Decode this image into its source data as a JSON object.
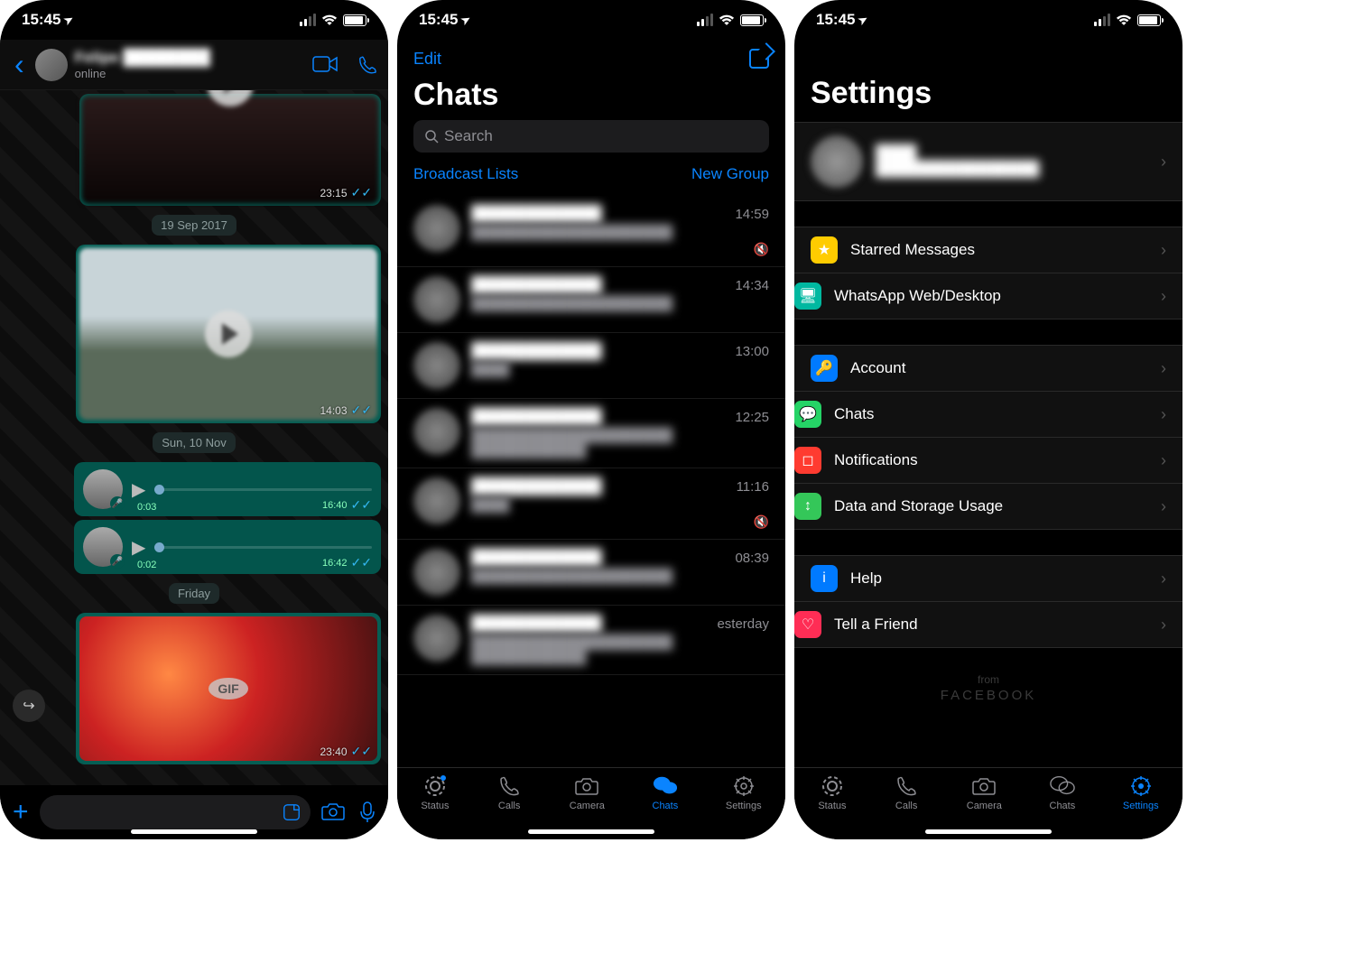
{
  "status": {
    "time": "15:45",
    "location_arrow": "➤"
  },
  "screen1": {
    "contact_name": "Felipe ████████",
    "contact_status": "online",
    "dates": {
      "d1": "19 Sep 2017",
      "d2": "Sun, 10 Nov",
      "d3": "Friday"
    },
    "bubbles": {
      "v0_time": "23:15",
      "v1_time": "14:03",
      "voice1_dur": "0:03",
      "voice1_time": "16:40",
      "voice2_dur": "0:02",
      "voice2_time": "16:42",
      "gif_label": "GIF",
      "gif_time": "23:40"
    }
  },
  "screen2": {
    "edit": "Edit",
    "title": "Chats",
    "search_placeholder": "Search",
    "broadcast": "Broadcast Lists",
    "newgroup": "New Group",
    "rows": [
      {
        "time": "14:59",
        "muted": true
      },
      {
        "time": "14:34",
        "muted": false
      },
      {
        "time": "13:00",
        "muted": false
      },
      {
        "time": "12:25",
        "muted": false
      },
      {
        "time": "11:16",
        "muted": true
      },
      {
        "time": "08:39",
        "muted": false
      },
      {
        "time": "esterday",
        "muted": false
      }
    ],
    "tabs": {
      "status": "Status",
      "calls": "Calls",
      "camera": "Camera",
      "chats": "Chats",
      "settings": "Settings"
    }
  },
  "screen3": {
    "title": "Settings",
    "items": {
      "starred": "Starred Messages",
      "web": "WhatsApp Web/Desktop",
      "account": "Account",
      "chats": "Chats",
      "notif": "Notifications",
      "data": "Data and Storage Usage",
      "help": "Help",
      "tell": "Tell a Friend"
    },
    "from": "from",
    "facebook": "FACEBOOK",
    "tabs": {
      "status": "Status",
      "calls": "Calls",
      "camera": "Camera",
      "chats": "Chats",
      "settings": "Settings"
    }
  }
}
